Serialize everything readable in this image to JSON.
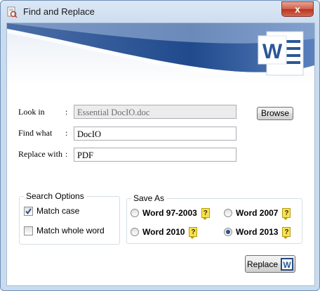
{
  "window": {
    "title": "Find and Replace",
    "close_glyph": "x"
  },
  "form": {
    "look_in_label": "Look in",
    "look_in_value": "Essential DocIO.doc",
    "find_label": "Find what",
    "find_value": "DocIO",
    "replace_label": "Replace with",
    "replace_value": "PDF",
    "colon": ":",
    "browse_label": "Browse"
  },
  "search_options": {
    "title": "Search Options",
    "match_case": {
      "label": "Match case",
      "checked": true
    },
    "match_whole_word": {
      "label": "Match whole word",
      "checked": false
    }
  },
  "save_as": {
    "title": "Save As",
    "options": [
      {
        "label": "Word 97-2003",
        "selected": false
      },
      {
        "label": "Word 2007",
        "selected": false
      },
      {
        "label": "Word 2010",
        "selected": false
      },
      {
        "label": "Word 2013",
        "selected": true
      }
    ],
    "help_glyph": "?"
  },
  "replace_button": {
    "label": "Replace"
  },
  "colors": {
    "accent": "#2b5797",
    "window_border": "#6d8fb5"
  }
}
